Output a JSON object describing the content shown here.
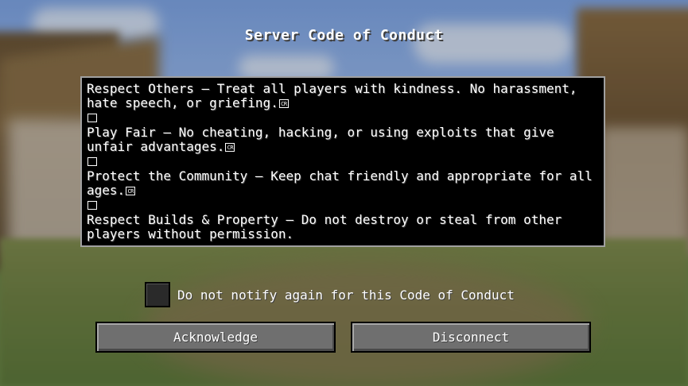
{
  "dialog": {
    "title": "Server Code of Conduct",
    "rules": [
      "Respect Others — Treat all players with kindness. No harassment, hate speech, or griefing.",
      "Play Fair — No cheating, hacking, or using exploits that give unfair advantages.",
      "Protect the Community — Keep chat friendly and appropriate for all ages.",
      "Respect Builds & Property — Do not destroy or steal from other players without permission."
    ],
    "line_break_glyph": "CR",
    "checkbox_label": "Do not notify again for this Code of Conduct",
    "checkbox_checked": false,
    "acknowledge_label": "Acknowledge",
    "disconnect_label": "Disconnect"
  }
}
